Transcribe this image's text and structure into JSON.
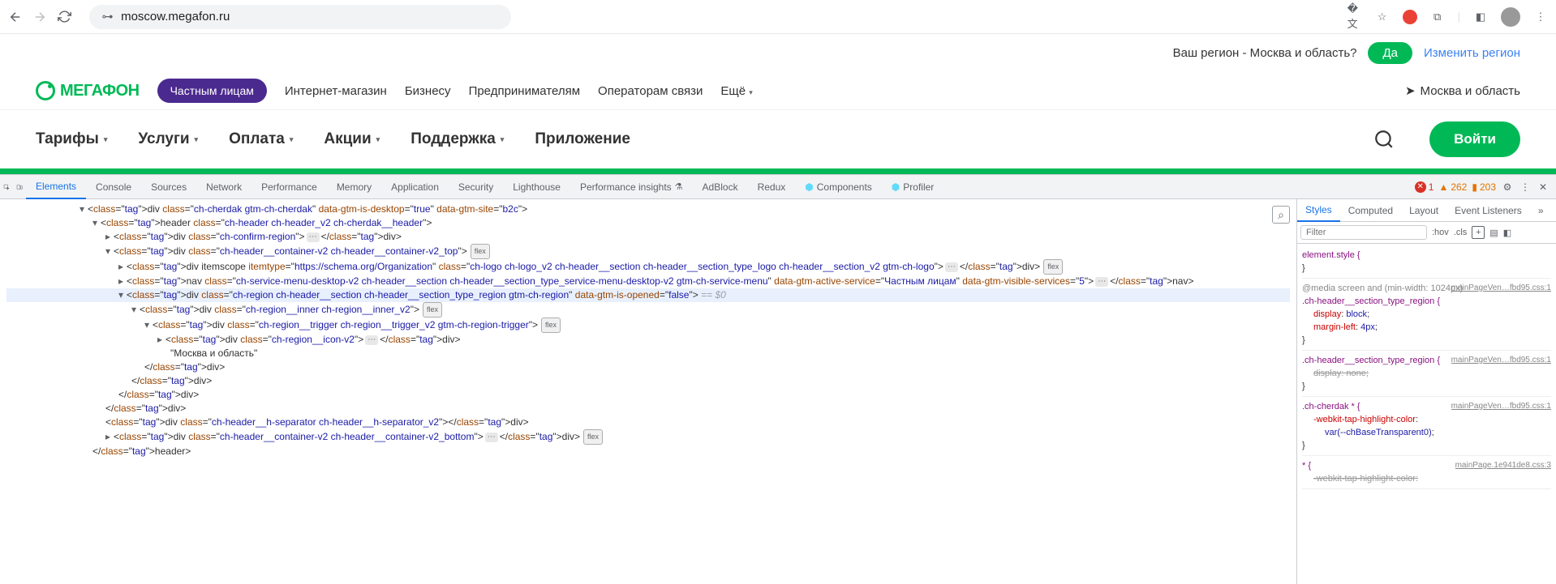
{
  "browser": {
    "url": "moscow.megafon.ru"
  },
  "confirm": {
    "question": "Ваш регион - Москва и область?",
    "yes": "Да",
    "change": "Изменить регион"
  },
  "logo": {
    "text": "МЕГАФОН"
  },
  "topnav": {
    "personal": "Частным лицам",
    "shop": "Интернет-магазин",
    "business": "Бизнесу",
    "entrepreneur": "Предпринимателям",
    "operators": "Операторам связи",
    "more": "Ещё"
  },
  "region": "Москва и область",
  "mainnav": {
    "tariffs": "Тарифы",
    "services": "Услуги",
    "payment": "Оплата",
    "promo": "Акции",
    "support": "Поддержка",
    "app": "Приложение",
    "login": "Войти"
  },
  "dt": {
    "tabs": {
      "elements": "Elements",
      "console": "Console",
      "sources": "Sources",
      "network": "Network",
      "performance": "Performance",
      "memory": "Memory",
      "application": "Application",
      "security": "Security",
      "lighthouse": "Lighthouse",
      "insights": "Performance insights",
      "adblock": "AdBlock",
      "redux": "Redux",
      "components": "Components",
      "profiler": "Profiler"
    },
    "errors": "1",
    "warnings": "262",
    "issues": "203"
  },
  "dom": {
    "l1": "<div class=\"ch-cherdak gtm-ch-cherdak\" data-gtm-is-desktop=\"true\" data-gtm-site=\"b2c\">",
    "l2": "<header class=\"ch-header ch-header_v2 ch-cherdak__header\">",
    "l3": "<div class=\"ch-confirm-region\">…</div>",
    "l4": "<div class=\"ch-header__container-v2 ch-header__container-v2_top\">",
    "l5": "<div itemscope itemtype=\"https://schema.org/Organization\" class=\"ch-logo ch-logo_v2 ch-header__section ch-header__section_type_logo ch-header__section_v2 gtm-ch-logo\">…</div>",
    "l6": "<nav class=\"ch-service-menu-desktop-v2 ch-header__section ch-header__section_type_service-menu-desktop-v2 gtm-ch-service-menu\" data-gtm-active-service=\"Частным лицам\" data-gtm-visible-services=\"5\">…</nav>",
    "l7": "<div class=\"ch-region ch-header__section ch-header__section_type_region gtm-ch-region\" data-gtm-is-opened=\"false\">",
    "l8": "<div class=\"ch-region__inner ch-region__inner_v2\">",
    "l9": "<div class=\"ch-region__trigger ch-region__trigger_v2 gtm-ch-region-trigger\">",
    "l10": "<div class=\"ch-region__icon-v2\">…</div>",
    "l11": "\"Москва и область\"",
    "l12": "</div>",
    "l13": "</div>",
    "l14": "</div>",
    "l15": "</div>",
    "l16": "<div class=\"ch-header__h-separator ch-header__h-separator_v2\"></div>",
    "l17": "<div class=\"ch-header__container-v2 ch-header__container-v2_bottom\">…</div>",
    "l18": "</header>",
    "eq0": " == $0",
    "flex": "flex"
  },
  "sp": {
    "tabs": {
      "styles": "Styles",
      "computed": "Computed",
      "layout": "Layout",
      "listeners": "Event Listeners"
    },
    "filter_ph": "Filter",
    "hov": ":hov",
    "cls": ".cls"
  },
  "css": {
    "r1_sel": "element.style {",
    "media": "@media screen and (min-width: 1024px)",
    "r2_sel": ".ch-header__section_type_region {",
    "r2_src": "mainPageVen…fbd95.css:1",
    "r2_p1n": "display",
    "r2_p1v": "block",
    "r2_p2n": "margin-left",
    "r2_p2v": "4px",
    "r3_sel": ".ch-header__section_type_region {",
    "r3_src": "mainPageVen…fbd95.css:1",
    "r3_p1n": "display",
    "r3_p1v": "none",
    "r4_sel": ".ch-cherdak * {",
    "r4_src": "mainPageVen…fbd95.css:1",
    "r4_p1n": "-webkit-tap-highlight-color",
    "r4_p1v": "var(--chBaseTransparent0)",
    "r5_sel": "* {",
    "r5_src": "mainPage.1e941de8.css:3",
    "r5_p1n": "-webkit-tap-highlight-color"
  }
}
